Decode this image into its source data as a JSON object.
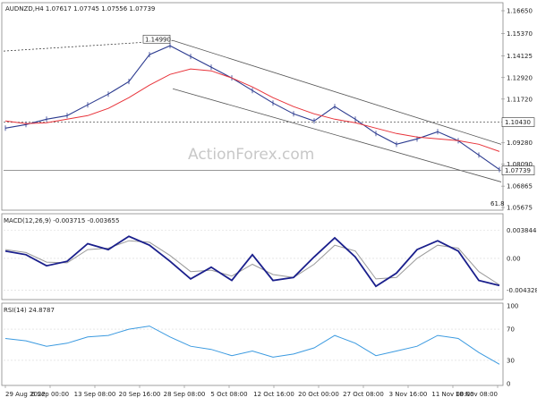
{
  "header": {
    "symbol_line": "AUDNZD,H4  1.07617 1.07745 1.07556 1.07739",
    "watermark": "ActionForex.com"
  },
  "colors": {
    "price": "#2b3a8f",
    "ma": "#e8333a",
    "channel": "#555555",
    "macd_main": "#1a1f8c",
    "macd_signal": "#9a9a9a",
    "rsi": "#3b9ae0",
    "grid": "#d8d8d8",
    "watermark": "#c8c8c8"
  },
  "chart_data": [
    {
      "type": "line",
      "panel": "price",
      "title": "AUDNZD,H4  1.07617 1.07745 1.07556 1.07739",
      "series_style": "bars",
      "ylim": [
        1.05675,
        1.1665
      ],
      "yticks": [
        "1.16650",
        "1.15370",
        "1.14125",
        "1.12920",
        "1.11720",
        "1.10430",
        "1.09280",
        "1.08090",
        "1.06865",
        "1.05675"
      ],
      "highlighted_levels": [
        {
          "value": 1.1043,
          "label": "1.10430",
          "style": "dotted"
        },
        {
          "value": 1.07739,
          "label": "1.07739",
          "style": "solid"
        }
      ],
      "annotations": [
        {
          "label": "1.14990",
          "value": 1.1499
        },
        {
          "label": "61.8"
        }
      ],
      "x": [
        "29 Aug 2022",
        "6 Sep 00:00",
        "13 Sep 08:00",
        "20 Sep 16:00",
        "28 Sep 08:00",
        "5 Oct 08:00",
        "12 Oct 16:00",
        "20 Oct 00:00",
        "27 Oct 08:00",
        "3 Nov 16:00",
        "11 Nov 00:00",
        "18 Nov 08:00"
      ],
      "series": [
        {
          "key": "price",
          "values": [
            1.101,
            1.103,
            1.106,
            1.108,
            1.114,
            1.12,
            1.127,
            1.142,
            1.147,
            1.141,
            1.135,
            1.129,
            1.122,
            1.115,
            1.109,
            1.105,
            1.113,
            1.106,
            1.098,
            1.092,
            1.095,
            1.099,
            1.094,
            1.086,
            1.0779
          ]
        },
        {
          "key": "ma",
          "values": [
            1.105,
            1.1035,
            1.104,
            1.106,
            1.108,
            1.112,
            1.118,
            1.125,
            1.131,
            1.134,
            1.133,
            1.129,
            1.124,
            1.118,
            1.113,
            1.109,
            1.106,
            1.104,
            1.101,
            1.098,
            1.096,
            1.095,
            1.094,
            1.092,
            1.088
          ]
        }
      ],
      "channel": {
        "upper": [
          {
            "x": 0.34,
            "y": 1.1499
          },
          {
            "x": 1.0,
            "y": 1.092
          }
        ],
        "lower": [
          {
            "x": 0.34,
            "y": 1.123
          },
          {
            "x": 1.0,
            "y": 1.071
          }
        ],
        "prior_trendline": [
          {
            "x": 0.0,
            "y": 1.144
          },
          {
            "x": 0.34,
            "y": 1.1499
          }
        ]
      }
    },
    {
      "type": "line",
      "panel": "macd",
      "title": "MACD(12,26,9) -0.003715 -0.003655",
      "yticks": [
        "0.003844",
        "0.00",
        "-0.004328"
      ],
      "ylim": [
        -0.005,
        0.0045
      ],
      "series": [
        {
          "key": "macd",
          "values": [
            0.001,
            0.0005,
            -0.001,
            -0.0004,
            0.002,
            0.0012,
            0.003,
            0.0018,
            -0.0004,
            -0.0028,
            -0.0012,
            -0.003,
            0.0005,
            -0.003,
            -0.0026,
            0.0002,
            0.0028,
            0.0002,
            -0.0038,
            -0.002,
            0.0012,
            0.0024,
            0.001,
            -0.003,
            -0.0037
          ]
        },
        {
          "key": "signal",
          "values": [
            0.0012,
            0.0008,
            -0.0005,
            -0.0006,
            0.0012,
            0.0014,
            0.0024,
            0.0022,
            0.0004,
            -0.0018,
            -0.0016,
            -0.0024,
            -0.0008,
            -0.0022,
            -0.0026,
            -0.0008,
            0.0018,
            0.001,
            -0.0028,
            -0.0026,
            0.0,
            0.0018,
            0.0014,
            -0.0018,
            -0.0036
          ]
        }
      ]
    },
    {
      "type": "line",
      "panel": "rsi",
      "title": "RSI(14) 24.8787",
      "ylim": [
        0,
        100
      ],
      "yticks": [
        "100",
        "70",
        "30",
        "0"
      ],
      "series": [
        {
          "key": "rsi",
          "values": [
            58,
            55,
            48,
            52,
            60,
            62,
            70,
            74,
            60,
            48,
            44,
            36,
            42,
            34,
            38,
            46,
            62,
            52,
            36,
            42,
            48,
            62,
            58,
            40,
            25
          ]
        }
      ]
    }
  ]
}
